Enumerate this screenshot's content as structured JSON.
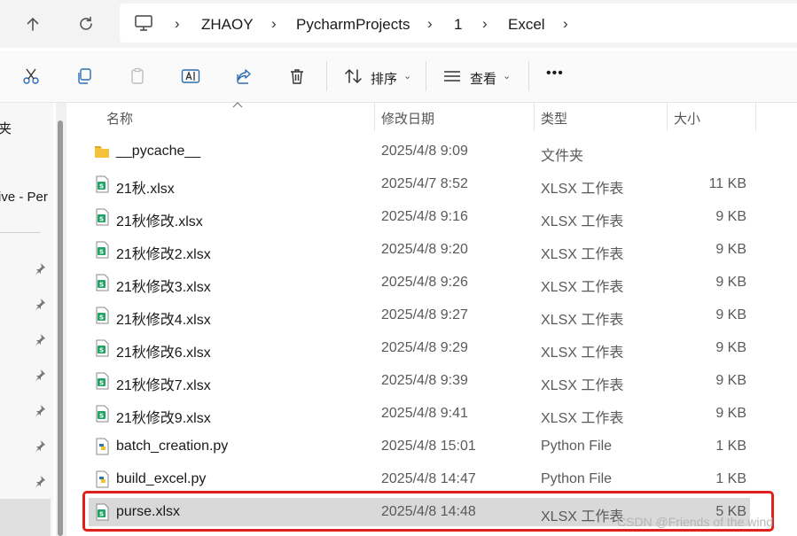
{
  "breadcrumb": [
    "ZHAOY",
    "PycharmProjects",
    "1",
    "Excel"
  ],
  "toolbar": {
    "sort_label": "排序",
    "view_label": "查看",
    "more_label": "•••"
  },
  "navpane": {
    "item_top": "夹",
    "item_cloud": "ive - Per"
  },
  "columns": {
    "name": "名称",
    "date": "修改日期",
    "type": "类型",
    "size": "大小"
  },
  "files": [
    {
      "name": "__pycache__",
      "date": "2025/4/8 9:09",
      "type": "文件夹",
      "size": "",
      "icon": "folder-icon"
    },
    {
      "name": "21秋.xlsx",
      "date": "2025/4/7 8:52",
      "type": "XLSX 工作表",
      "size": "11 KB",
      "icon": "excel-file-icon"
    },
    {
      "name": "21秋修改.xlsx",
      "date": "2025/4/8 9:16",
      "type": "XLSX 工作表",
      "size": "9 KB",
      "icon": "excel-file-icon"
    },
    {
      "name": "21秋修改2.xlsx",
      "date": "2025/4/8 9:20",
      "type": "XLSX 工作表",
      "size": "9 KB",
      "icon": "excel-file-icon"
    },
    {
      "name": "21秋修改3.xlsx",
      "date": "2025/4/8 9:26",
      "type": "XLSX 工作表",
      "size": "9 KB",
      "icon": "excel-file-icon"
    },
    {
      "name": "21秋修改4.xlsx",
      "date": "2025/4/8 9:27",
      "type": "XLSX 工作表",
      "size": "9 KB",
      "icon": "excel-file-icon"
    },
    {
      "name": "21秋修改6.xlsx",
      "date": "2025/4/8 9:29",
      "type": "XLSX 工作表",
      "size": "9 KB",
      "icon": "excel-file-icon"
    },
    {
      "name": "21秋修改7.xlsx",
      "date": "2025/4/8 9:39",
      "type": "XLSX 工作表",
      "size": "9 KB",
      "icon": "excel-file-icon"
    },
    {
      "name": "21秋修改9.xlsx",
      "date": "2025/4/8 9:41",
      "type": "XLSX 工作表",
      "size": "9 KB",
      "icon": "excel-file-icon"
    },
    {
      "name": "batch_creation.py",
      "date": "2025/4/8 15:01",
      "type": "Python File",
      "size": "1 KB",
      "icon": "python-file-icon"
    },
    {
      "name": "build_excel.py",
      "date": "2025/4/8 14:47",
      "type": "Python File",
      "size": "1 KB",
      "icon": "python-file-icon"
    },
    {
      "name": "purse.xlsx",
      "date": "2025/4/8 14:48",
      "type": "XLSX 工作表",
      "size": "5 KB",
      "icon": "excel-file-icon"
    }
  ],
  "watermark": "CSDN @Friends of the wind",
  "colors": {
    "highlight": "#e0201a",
    "selected_row": "#d9d9d9",
    "excel_green": "#21a366",
    "folder_yellow": "#f5c33b"
  }
}
